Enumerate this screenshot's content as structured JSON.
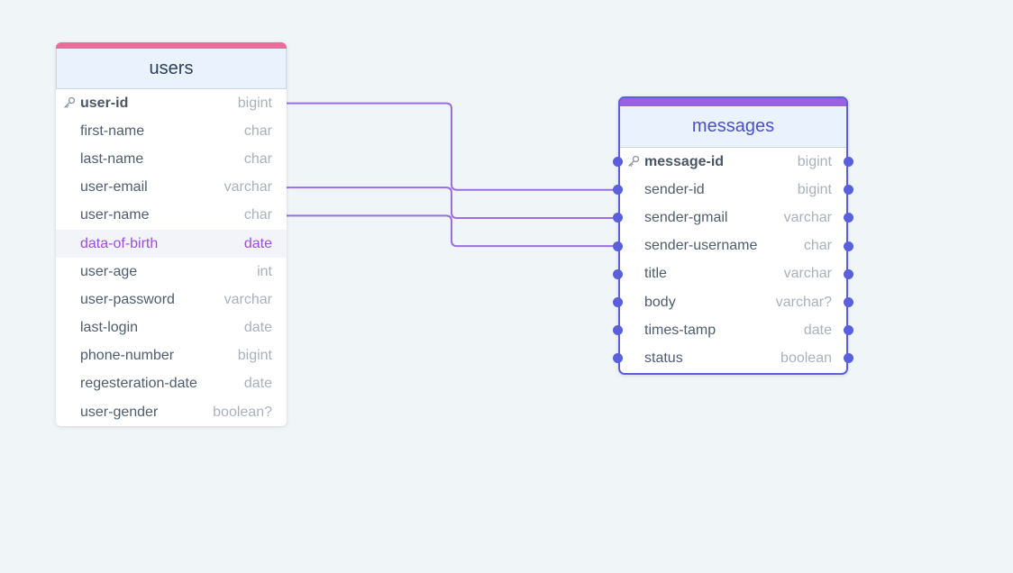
{
  "tables": {
    "users": {
      "name": "users",
      "accent": "#ee6b9a",
      "fields": [
        {
          "name": "user-id",
          "type": "bigint",
          "pk": true
        },
        {
          "name": "first-name",
          "type": "char"
        },
        {
          "name": "last-name",
          "type": "char"
        },
        {
          "name": "user-email",
          "type": "varchar"
        },
        {
          "name": "user-name",
          "type": "char"
        },
        {
          "name": "data-of-birth",
          "type": "date",
          "highlighted": true
        },
        {
          "name": "user-age",
          "type": "int"
        },
        {
          "name": "user-password",
          "type": "varchar"
        },
        {
          "name": "last-login",
          "type": "date"
        },
        {
          "name": "phone-number",
          "type": "bigint"
        },
        {
          "name": "regesteration-date",
          "type": "date"
        },
        {
          "name": "user-gender",
          "type": "boolean?"
        }
      ]
    },
    "messages": {
      "name": "messages",
      "accent": "#9b61e4",
      "border": "#5a5fdc",
      "fields": [
        {
          "name": "message-id",
          "type": "bigint",
          "pk": true
        },
        {
          "name": "sender-id",
          "type": "bigint"
        },
        {
          "name": "sender-gmail",
          "type": "varchar"
        },
        {
          "name": "sender-username",
          "type": "char"
        },
        {
          "name": "title",
          "type": "varchar"
        },
        {
          "name": "body",
          "type": "varchar?"
        },
        {
          "name": "times-tamp",
          "type": "date"
        },
        {
          "name": "status",
          "type": "boolean"
        }
      ]
    }
  },
  "relationships": [
    {
      "from": "users.user-id",
      "to": "messages.sender-id"
    },
    {
      "from": "users.user-email",
      "to": "messages.sender-gmail"
    },
    {
      "from": "users.user-name",
      "to": "messages.sender-username"
    }
  ],
  "colors": {
    "background": "#f0f5f8",
    "connector": "#9b6fe0",
    "highlight_text": "#9b4fd6"
  }
}
